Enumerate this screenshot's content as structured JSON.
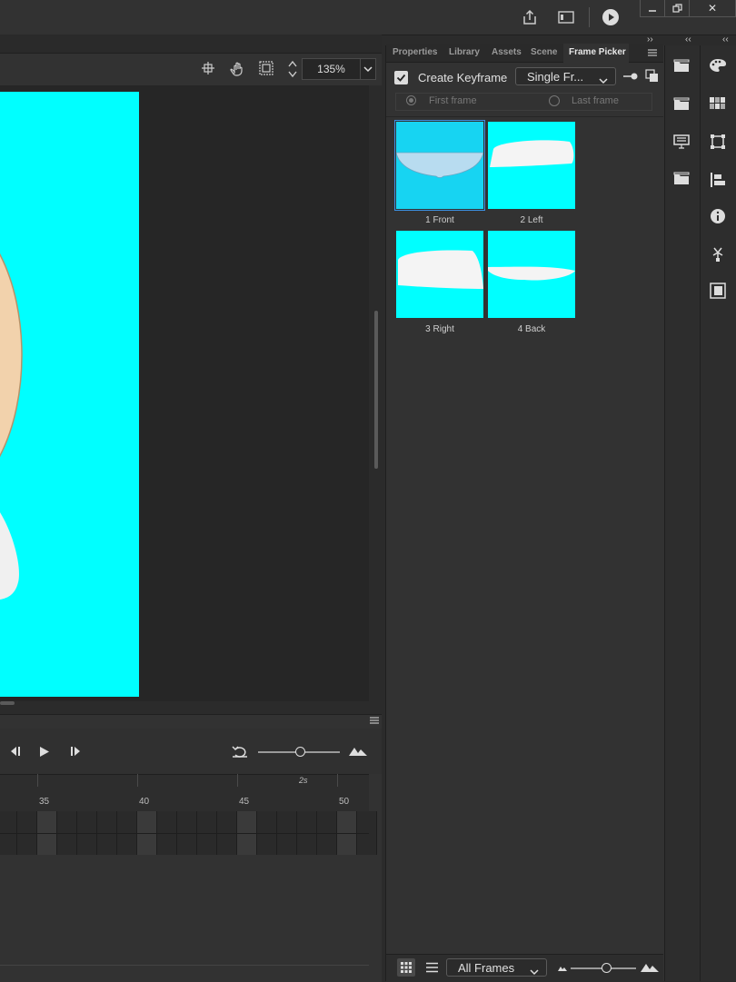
{
  "window": {
    "minimize_icon": "minimize-icon",
    "restore_icon": "restore-icon",
    "close_label": "✕"
  },
  "toolbar": {
    "share_icon": "share-icon",
    "layout_icon": "workspace-icon",
    "play_icon": "play-icon"
  },
  "stage": {
    "zoom_value": "135%",
    "background_color": "#00ffff"
  },
  "panel": {
    "collapse_glyph": "››",
    "tabs": [
      {
        "label": "Properties",
        "active": false
      },
      {
        "label": "Library",
        "active": false
      },
      {
        "label": "Assets",
        "active": false
      },
      {
        "label": "Scene",
        "active": false
      },
      {
        "label": "Frame Picker",
        "active": true
      }
    ],
    "create_keyframe_label": "Create Keyframe",
    "create_keyframe_checked": true,
    "mode_select": "Single Fr...",
    "first_frame_label": "First frame",
    "last_frame_label": "Last frame",
    "frames": [
      {
        "label": "1 Front",
        "selected": true
      },
      {
        "label": "2 Left",
        "selected": false
      },
      {
        "label": "3 Right",
        "selected": false
      },
      {
        "label": "4 Back",
        "selected": false
      }
    ],
    "footer": {
      "filter_select": "All Frames"
    }
  },
  "timeline": {
    "time_marker": "2s",
    "frame_numbers": [
      "35",
      "40",
      "45",
      "50"
    ]
  },
  "docks": {
    "dock1": [
      "library-folder-icon",
      "library-folder-icon",
      "presentation-icon",
      "library-folder-icon"
    ],
    "dock2": [
      "color-palette-icon",
      "swatches-icon",
      "transform-icon",
      "align-icon",
      "info-icon",
      "code-snippets-icon",
      "components-icon"
    ]
  },
  "collapse_glyph": "‹‹"
}
